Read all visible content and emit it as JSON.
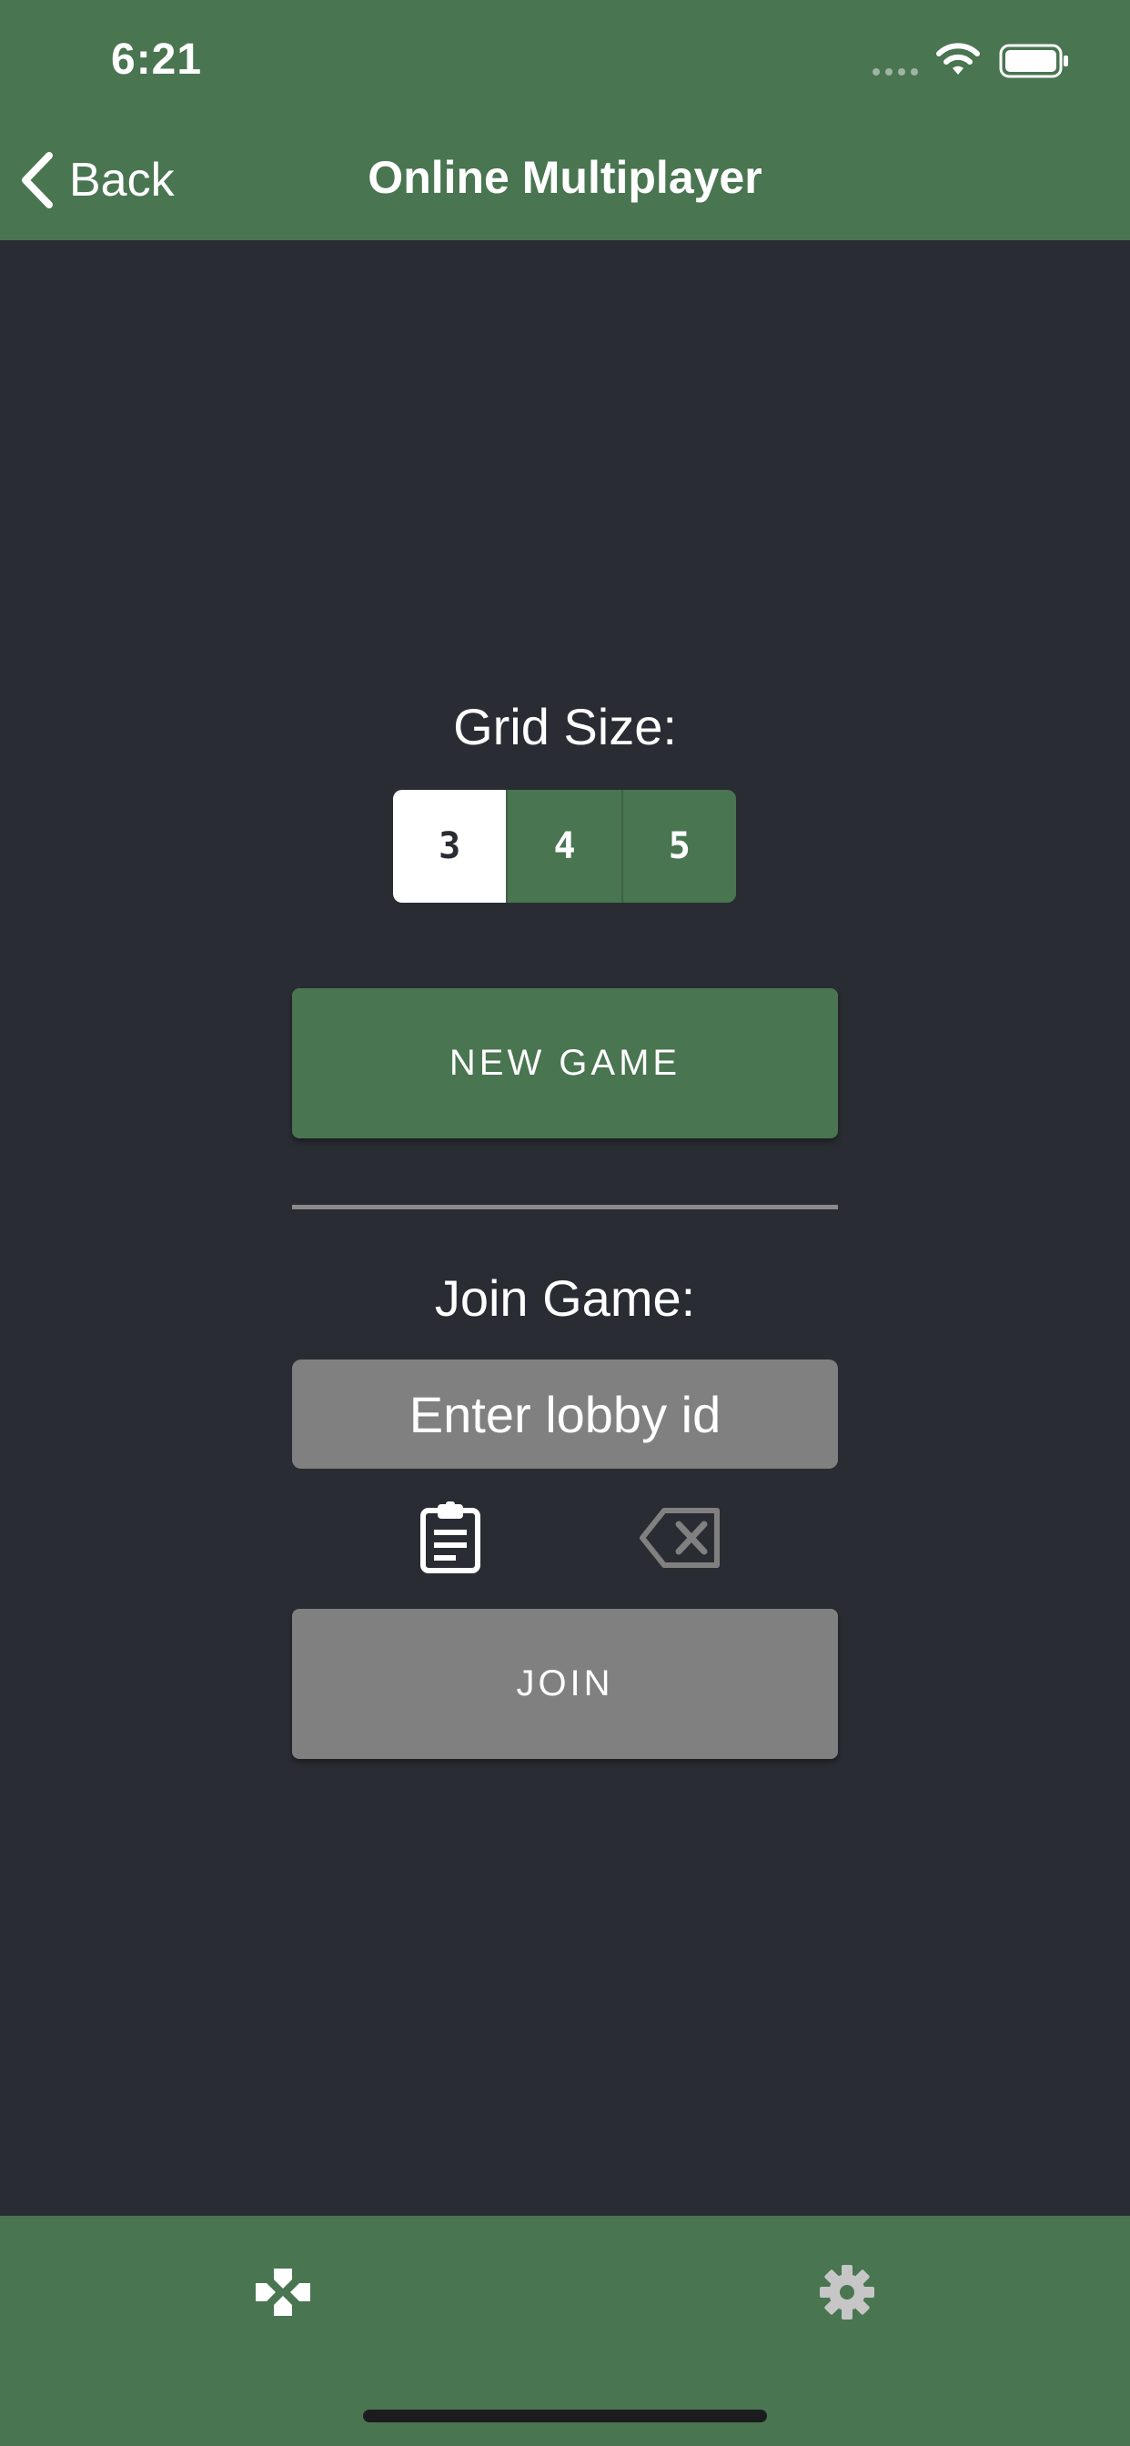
{
  "status_bar": {
    "time": "6:21"
  },
  "nav": {
    "back_label": "Back",
    "title": "Online Multiplayer"
  },
  "grid": {
    "label": "Grid Size:",
    "options": [
      "3",
      "4",
      "5"
    ],
    "selected": "3"
  },
  "new_game_label": "NEW GAME",
  "join": {
    "label": "Join Game:",
    "input_value": "",
    "input_placeholder": "Enter lobby id",
    "button_label": "JOIN"
  },
  "icons": {
    "paste": "clipboard-icon",
    "clear": "backspace-icon",
    "tab_games": "gamepad-icon",
    "tab_settings": "gear-icon"
  },
  "colors": {
    "primary_green": "#497551",
    "background": "#2a2c34",
    "disabled_gray": "#808080"
  }
}
